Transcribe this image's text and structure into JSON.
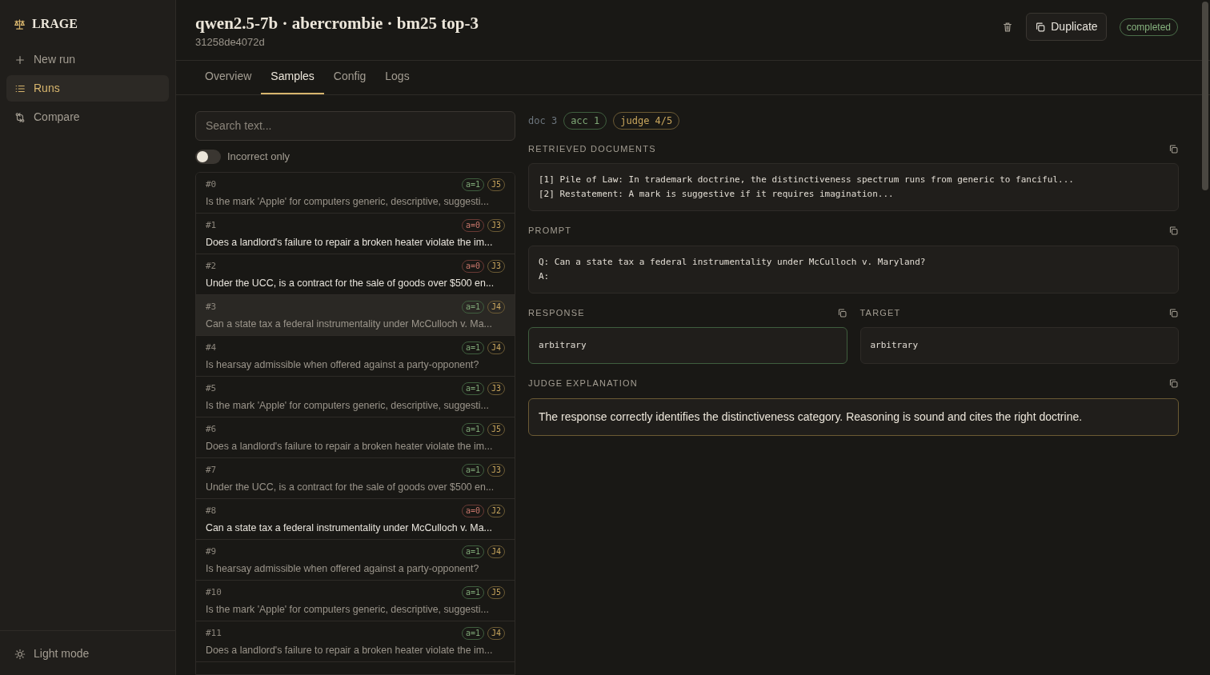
{
  "sidebar": {
    "brand": "LRAGE",
    "items": [
      {
        "label": "New run",
        "kind": "plus",
        "selected": false
      },
      {
        "label": "Runs",
        "kind": "list",
        "selected": true
      },
      {
        "label": "Compare",
        "kind": "compare",
        "selected": false
      }
    ],
    "footer": {
      "label": "Light mode"
    }
  },
  "header": {
    "title": "qwen2.5-7b · abercrombie · bm25 top-3",
    "run_id": "31258de4072d",
    "duplicate": "Duplicate",
    "status": "completed"
  },
  "tabs": [
    {
      "label": "Overview",
      "selected": false
    },
    {
      "label": "Samples",
      "selected": true
    },
    {
      "label": "Config",
      "selected": false
    },
    {
      "label": "Logs",
      "selected": false
    }
  ],
  "search": {
    "placeholder": "Search text..."
  },
  "filter": {
    "label": "Incorrect only",
    "on": false
  },
  "samples": [
    {
      "index": "#0",
      "accuracy": "a=1",
      "correct": true,
      "judge": "J5",
      "question": "Is the mark 'Apple' for computers generic, descriptive, suggesti...",
      "dimmed": true,
      "selected": false
    },
    {
      "index": "#1",
      "accuracy": "a=0",
      "correct": false,
      "judge": "J3",
      "question": "Does a landlord's failure to repair a broken heater violate the im...",
      "dimmed": false,
      "selected": false
    },
    {
      "index": "#2",
      "accuracy": "a=0",
      "correct": false,
      "judge": "J3",
      "question": "Under the UCC, is a contract for the sale of goods over $500 en...",
      "dimmed": false,
      "selected": false
    },
    {
      "index": "#3",
      "accuracy": "a=1",
      "correct": true,
      "judge": "J4",
      "question": "Can a state tax a federal instrumentality under McCulloch v. Ma...",
      "dimmed": true,
      "selected": true
    },
    {
      "index": "#4",
      "accuracy": "a=1",
      "correct": true,
      "judge": "J4",
      "question": "Is hearsay admissible when offered against a party-opponent?",
      "dimmed": true,
      "selected": false
    },
    {
      "index": "#5",
      "accuracy": "a=1",
      "correct": true,
      "judge": "J3",
      "question": "Is the mark 'Apple' for computers generic, descriptive, suggesti...",
      "dimmed": true,
      "selected": false
    },
    {
      "index": "#6",
      "accuracy": "a=1",
      "correct": true,
      "judge": "J5",
      "question": "Does a landlord's failure to repair a broken heater violate the im...",
      "dimmed": true,
      "selected": false
    },
    {
      "index": "#7",
      "accuracy": "a=1",
      "correct": true,
      "judge": "J3",
      "question": "Under the UCC, is a contract for the sale of goods over $500 en...",
      "dimmed": true,
      "selected": false
    },
    {
      "index": "#8",
      "accuracy": "a=0",
      "correct": false,
      "judge": "J2",
      "question": "Can a state tax a federal instrumentality under McCulloch v. Ma...",
      "dimmed": false,
      "selected": false
    },
    {
      "index": "#9",
      "accuracy": "a=1",
      "correct": true,
      "judge": "J4",
      "question": "Is hearsay admissible when offered against a party-opponent?",
      "dimmed": true,
      "selected": false
    },
    {
      "index": "#10",
      "accuracy": "a=1",
      "correct": true,
      "judge": "J5",
      "question": "Is the mark 'Apple' for computers generic, descriptive, suggesti...",
      "dimmed": true,
      "selected": false
    },
    {
      "index": "#11",
      "accuracy": "a=1",
      "correct": true,
      "judge": "J4",
      "question": "Does a landlord's failure to repair a broken heater violate the im...",
      "dimmed": true,
      "selected": false
    }
  ],
  "detail": {
    "doc": "doc 3",
    "accuracy": "acc 1",
    "judge": "judge 4/5",
    "retrieved": {
      "label": "RETRIEVED DOCUMENTS",
      "lines": [
        "[1] Pile of Law: In trademark doctrine, the distinctiveness spectrum runs from generic to fanciful...",
        "[2] Restatement: A mark is suggestive if it requires imagination..."
      ]
    },
    "prompt": {
      "label": "PROMPT",
      "lines": [
        "Q: Can a state tax a federal instrumentality under McCulloch v. Maryland?",
        "A:"
      ]
    },
    "response": {
      "label": "RESPONSE",
      "text": "arbitrary",
      "correct": true
    },
    "target": {
      "label": "TARGET",
      "text": "arbitrary"
    },
    "judge_explanation": {
      "label": "JUDGE EXPLANATION",
      "text": "The response correctly identifies the distinctiveness category. Reasoning is sound and cites the right doctrine."
    }
  }
}
